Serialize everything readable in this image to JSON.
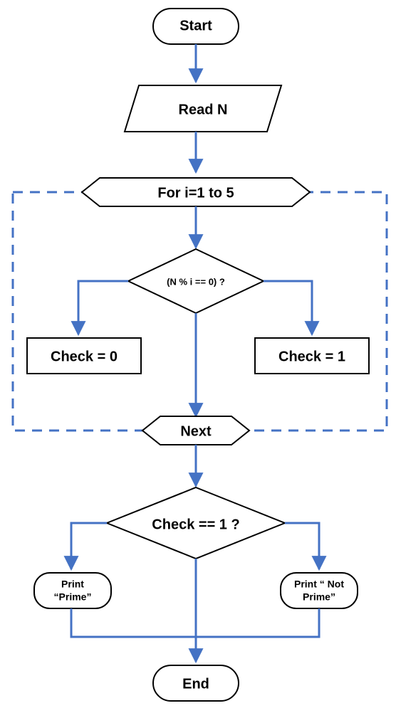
{
  "flowchart": {
    "start": "Start",
    "read": "Read N",
    "loop": "For i=1 to 5",
    "cond1": "(N % i == 0) ?",
    "check0": "Check = 0",
    "check1": "Check = 1",
    "next": "Next",
    "cond2": "Check == 1 ?",
    "printPrime1": "Print",
    "printPrime2": "“Prime”",
    "printNot1": "Print “ Not",
    "printNot2": "Prime”",
    "end": "End"
  },
  "style": {
    "stroke": "#4472C4",
    "dash": "#4472C4"
  }
}
